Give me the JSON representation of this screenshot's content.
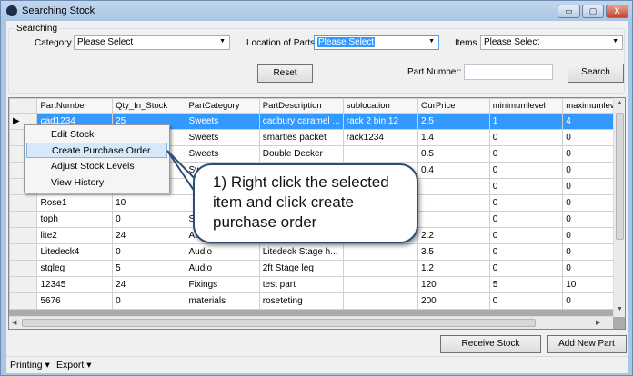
{
  "window": {
    "title": "Searching Stock",
    "min": "▭",
    "max": "▢",
    "close": "X"
  },
  "search": {
    "group_label": "Searching",
    "category_label": "Category",
    "category_value": "Please Select",
    "location_label": "Location of Parts",
    "location_value": "Please Select",
    "items_label": "Items",
    "items_value": "Please Select",
    "reset": "Reset",
    "part_number_label": "Part Number:",
    "part_number_value": "",
    "search": "Search"
  },
  "grid": {
    "columns": [
      "PartNumber",
      "Qty_In_Stock",
      "PartCategory",
      "PartDescription",
      "sublocation",
      "OurPrice",
      "minimumlevel",
      "maximumlevel"
    ],
    "rows": [
      [
        "cad1234",
        "25",
        "Sweets",
        "cadbury caramel ...",
        "rack 2 bin 12",
        "2.5",
        "1",
        "4"
      ],
      [
        "",
        "",
        "Sweets",
        "smarties packet",
        "rack1234",
        "1.4",
        "0",
        "0"
      ],
      [
        "",
        "",
        "Sweets",
        "Double Decker",
        "",
        "0.5",
        "0",
        "0"
      ],
      [
        "",
        "",
        "Sw",
        "",
        "",
        "0.4",
        "0",
        "0"
      ],
      [
        "",
        "",
        "",
        "",
        "",
        "",
        "0",
        "0"
      ],
      [
        "Rose1",
        "10",
        "",
        "",
        "",
        "",
        "0",
        "0"
      ],
      [
        "toph",
        "0",
        "Sw",
        "",
        "",
        "",
        "0",
        "0"
      ],
      [
        "lite2",
        "24",
        "Audio",
        "",
        "",
        "2.2",
        "0",
        "0"
      ],
      [
        "Litedeck4",
        "0",
        "Audio",
        "Litedeck Stage h...",
        "",
        "3.5",
        "0",
        "0"
      ],
      [
        "stgleg",
        "5",
        "Audio",
        "2ft Stage leg",
        "",
        "1.2",
        "0",
        "0"
      ],
      [
        "12345",
        "24",
        "Fixings",
        "test part",
        "",
        "120",
        "5",
        "10"
      ],
      [
        "5676",
        "0",
        "materials",
        "roseteting",
        "",
        "200",
        "0",
        "0"
      ]
    ],
    "selected_row": 0
  },
  "context_menu": {
    "items": [
      "Edit Stock",
      "Create Purchase Order",
      "Adjust Stock Levels",
      "View History"
    ],
    "highlighted": 1
  },
  "callout": {
    "text": "1) Right click the selected item and click create purchase order"
  },
  "buttons": {
    "receive_stock": "Receive Stock",
    "add_new_part": "Add New Part"
  },
  "statusbar": {
    "printing": "Printing ▾",
    "export": "Export ▾"
  },
  "colors": {
    "selection": "#3399ff",
    "callout_border": "#2c4d75"
  }
}
